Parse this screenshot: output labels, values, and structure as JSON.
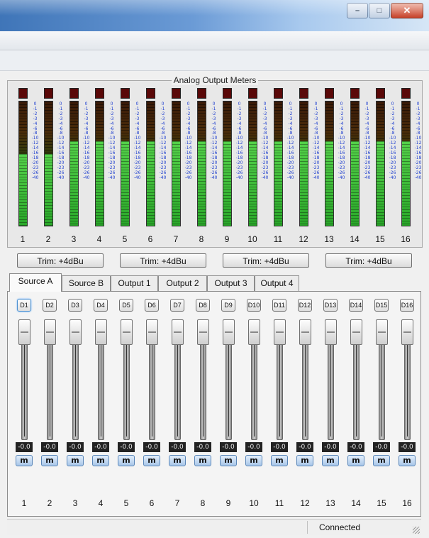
{
  "window": {
    "title": "",
    "controls": [
      {
        "name": "minimize-button",
        "glyph": "–"
      },
      {
        "name": "maximize-button",
        "glyph": "□"
      },
      {
        "name": "close-button",
        "glyph": "✕"
      }
    ]
  },
  "meters": {
    "title": "Analog Output Meters",
    "scale": [
      "0",
      "-1",
      "-2",
      "-3",
      "-4",
      "-6",
      "-8",
      "-10",
      "-12",
      "-14",
      "-16",
      "-18",
      "-20",
      "-23",
      "-26",
      "-40"
    ],
    "channels": [
      {
        "label": "1",
        "level": 0.58
      },
      {
        "label": "2",
        "level": 0.58
      },
      {
        "label": "3",
        "level": 0.68
      },
      {
        "label": "4",
        "level": 0.68
      },
      {
        "label": "5",
        "level": 0.68
      },
      {
        "label": "6",
        "level": 0.68
      },
      {
        "label": "7",
        "level": 0.68
      },
      {
        "label": "8",
        "level": 0.68
      },
      {
        "label": "9",
        "level": 0.68
      },
      {
        "label": "10",
        "level": 0.68
      },
      {
        "label": "11",
        "level": 0.68
      },
      {
        "label": "12",
        "level": 0.68
      },
      {
        "label": "13",
        "level": 0.68
      },
      {
        "label": "14",
        "level": 0.68
      },
      {
        "label": "15",
        "level": 0.68
      },
      {
        "label": "16",
        "level": 0.68
      }
    ]
  },
  "trim_buttons": [
    "Trim: +4dBu",
    "Trim: +4dBu",
    "Trim: +4dBu",
    "Trim: +4dBu"
  ],
  "tabs": [
    {
      "label": "Source A",
      "active": true
    },
    {
      "label": "Source B",
      "active": false
    },
    {
      "label": "Output 1",
      "active": false
    },
    {
      "label": "Output 2",
      "active": false
    },
    {
      "label": "Output 3",
      "active": false
    },
    {
      "label": "Output 4",
      "active": false
    }
  ],
  "strips": {
    "d_labels": [
      "D1",
      "D2",
      "D3",
      "D4",
      "D5",
      "D6",
      "D7",
      "D8",
      "D9",
      "D10",
      "D11",
      "D12",
      "D13",
      "D14",
      "D15",
      "D16"
    ],
    "values": [
      "-0.0",
      "-0.0",
      "-0.0",
      "-0.0",
      "-0.0",
      "-0.0",
      "-0.0",
      "-0.0",
      "-0.0",
      "-0.0",
      "-0.0",
      "-0.0",
      "-0.0",
      "-0.0",
      "-0.0",
      "-0.0"
    ],
    "mute_label": "m",
    "numbers": [
      "1",
      "2",
      "3",
      "4",
      "5",
      "6",
      "7",
      "8",
      "9",
      "10",
      "11",
      "12",
      "13",
      "14",
      "15",
      "16"
    ]
  },
  "status": {
    "text": "Connected"
  },
  "colors": {
    "active_tab_border": "#4a90d0",
    "meter_green": "#3fbf3a",
    "clip_red": "#5a0808",
    "scale_blue": "#2040d0"
  }
}
